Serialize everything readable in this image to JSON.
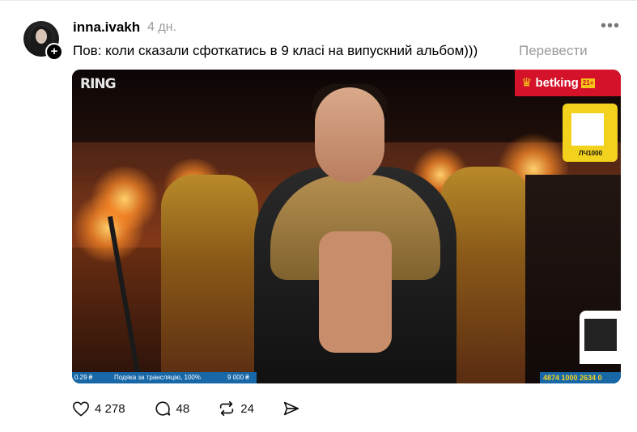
{
  "post": {
    "username": "inna.ivakh",
    "time": "4 дн.",
    "more_icon": "more-dots-icon",
    "caption": "Пов: коли сказали сфоткатись в 9 класі на випускний альбом)))",
    "translate": "Перевести"
  },
  "media": {
    "ring_logo": "RING",
    "brand": "betking",
    "brand_age": "21+",
    "brand_color": "#d4122a",
    "qr_code_text": "ЛЧ1000",
    "ticker_left_amount": "0.29 ₴",
    "ticker_left_text": "Подяка за трансляцію, 100%",
    "ticker_left_total": "9 000 ₴",
    "ticker_right": "4874 1000 2634 0"
  },
  "actions": {
    "like": {
      "icon": "heart-icon",
      "count": "4 278"
    },
    "comment": {
      "icon": "comment-icon",
      "count": "48"
    },
    "repost": {
      "icon": "repost-icon",
      "count": "24"
    },
    "share": {
      "icon": "share-icon"
    }
  }
}
